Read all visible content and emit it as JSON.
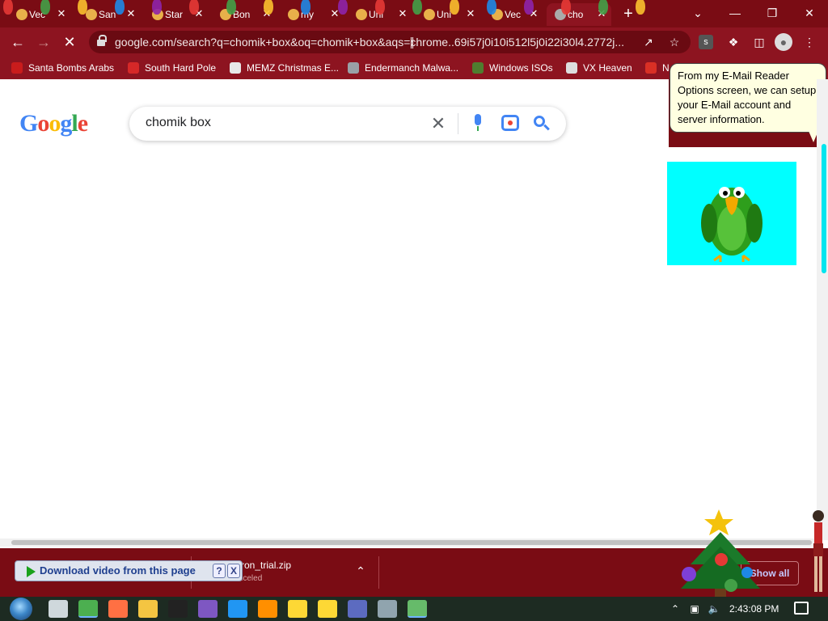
{
  "browser": {
    "tabs": [
      {
        "label": "Vec",
        "icon": "shield-icon",
        "active": false
      },
      {
        "label": "San",
        "icon": "page-icon",
        "active": false
      },
      {
        "label": "Star",
        "icon": "cube-icon",
        "active": false
      },
      {
        "label": "Bon",
        "icon": "balloon-icon",
        "active": false
      },
      {
        "label": "my",
        "icon": "page-icon",
        "active": false
      },
      {
        "label": "Uni",
        "icon": "unity-icon",
        "active": false
      },
      {
        "label": "Uni",
        "icon": "unity-icon",
        "active": false
      },
      {
        "label": "Vec",
        "icon": "shield-icon",
        "active": false
      },
      {
        "label": "cho",
        "icon": "google-icon",
        "active": true
      }
    ],
    "url": "google.com/search?q=chomik+box&oq=chomik+box&aqs=chrome..69i57j0i10i512l5j0i22i30l4.2772j...",
    "bookmarks": [
      {
        "label": "Santa Bombs Arabs",
        "color": "#c91c1c"
      },
      {
        "label": "South Hard Pole",
        "color": "#d62828"
      },
      {
        "label": "MEMZ Christmas E...",
        "color": "#e8e8e8"
      },
      {
        "label": "Endermanch Malwa...",
        "color": "#9aa0a6"
      },
      {
        "label": "Windows ISOs",
        "color": "#4f7d2f"
      },
      {
        "label": "VX Heaven",
        "color": "#dddddd"
      },
      {
        "label": "N",
        "color": "#d93025"
      }
    ]
  },
  "search": {
    "logo": [
      "G",
      "o",
      "o",
      "g",
      "l",
      "e"
    ],
    "query": "chomik box"
  },
  "agent": {
    "bubble_lines": [
      "From my E-Mail Reader",
      "Options screen, we can setup",
      "your E-Mail account and",
      "server information."
    ]
  },
  "downloads": {
    "items": [
      {
        "name": "",
        "status": "Canceled"
      },
      {
        "name": "ketron_trial.zip",
        "status": "Canceled"
      }
    ],
    "show_all": "Show all",
    "video_button": "Download video from this page",
    "help": "?",
    "close": "X"
  },
  "taskbar": {
    "apps": [
      {
        "name": "task-view-icon",
        "color": "#cfd8dc"
      },
      {
        "name": "chrome-icon",
        "color": "#4caf50"
      },
      {
        "name": "firefox-icon",
        "color": "#ff7043"
      },
      {
        "name": "file-explorer-icon",
        "color": "#f4c542"
      },
      {
        "name": "7zip-icon",
        "color": "#222222"
      },
      {
        "name": "shield-app-icon",
        "color": "#7e57c2"
      },
      {
        "name": "store-icon",
        "color": "#2196f3"
      },
      {
        "name": "vlc-icon",
        "color": "#ff8f00"
      },
      {
        "name": "help-app-icon",
        "color": "#fdd835"
      },
      {
        "name": "help-app-2-icon",
        "color": "#fdd835"
      },
      {
        "name": "b-app-icon",
        "color": "#5c6bc0"
      },
      {
        "name": "hex-app-icon",
        "color": "#90a4ae"
      },
      {
        "name": "unity-app-icon",
        "color": "#66bb6a"
      }
    ],
    "clock": "2:43:08 PM"
  },
  "colors": {
    "chrome_dark": "#7a0c14",
    "chrome": "#8d1420",
    "parrot_bg": "#00ffff",
    "google_blue": "#4285f4",
    "google_red": "#ea4335",
    "google_yellow": "#fbbc05",
    "google_green": "#34a853"
  }
}
